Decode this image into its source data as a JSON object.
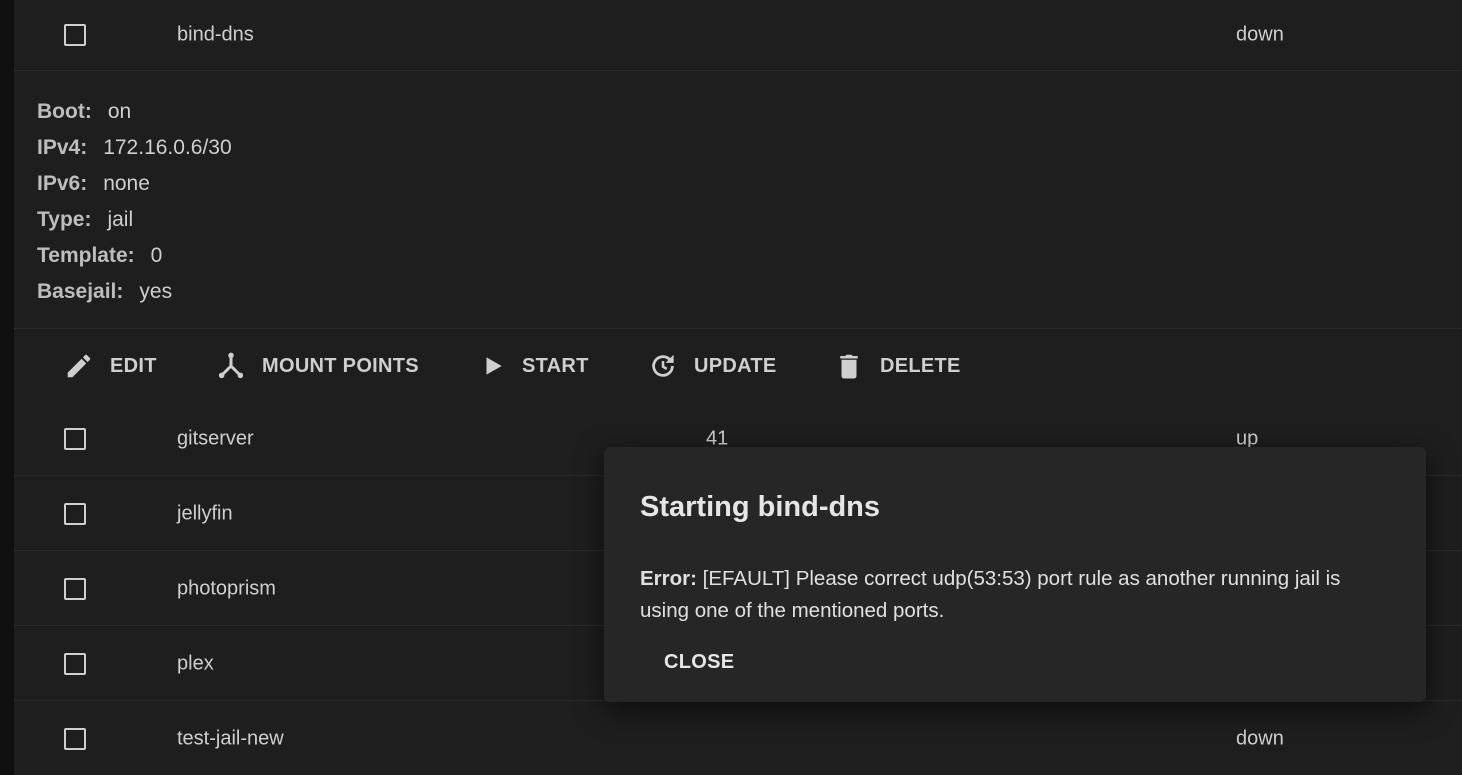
{
  "top_row": {
    "name": "bind-dns",
    "state": "down"
  },
  "details": [
    {
      "label": "Boot:",
      "value": "on"
    },
    {
      "label": "IPv4:",
      "value": "172.16.0.6/30"
    },
    {
      "label": "IPv6:",
      "value": "none"
    },
    {
      "label": "Type:",
      "value": "jail"
    },
    {
      "label": "Template:",
      "value": "0"
    },
    {
      "label": "Basejail:",
      "value": "yes"
    }
  ],
  "actions": {
    "edit": "EDIT",
    "mount_points": "MOUNT POINTS",
    "start": "START",
    "update": "UPDATE",
    "delete": "DELETE"
  },
  "rows": [
    {
      "name": "gitserver",
      "jid": "41",
      "state": "up"
    },
    {
      "name": "jellyfin",
      "jid": "",
      "state": ""
    },
    {
      "name": "photoprism",
      "jid": "",
      "state": ""
    },
    {
      "name": "plex",
      "jid": "",
      "state": ""
    },
    {
      "name": "test-jail-new",
      "jid": "",
      "state": "down"
    }
  ],
  "dialog": {
    "title": "Starting bind-dns",
    "error_label": "Error:",
    "error_message": "[EFAULT] Please correct udp(53:53) port rule as another running jail is using one of the mentioned ports.",
    "close_label": "CLOSE"
  },
  "colors": {
    "background": "#1e1e1e",
    "dialog": "#262626",
    "text": "#cfcfcf"
  }
}
